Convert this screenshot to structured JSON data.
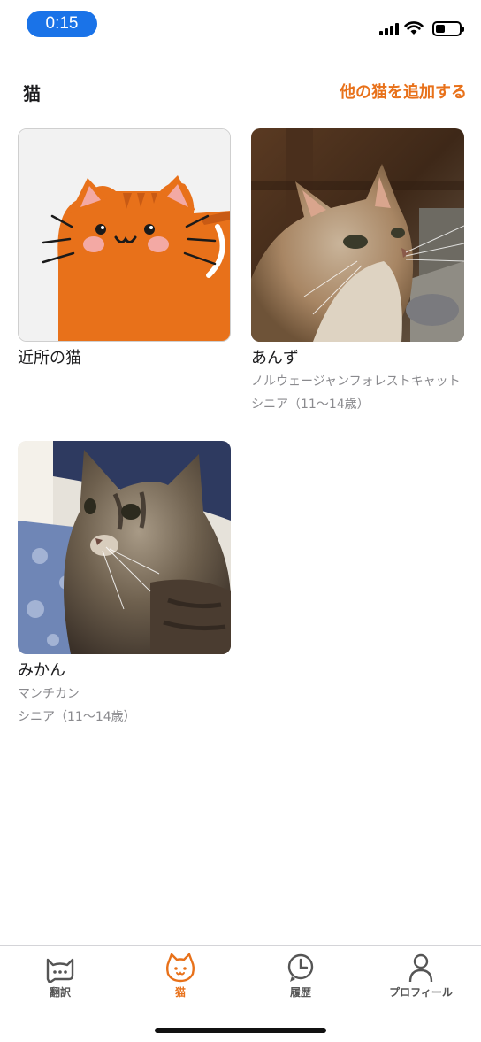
{
  "status_bar": {
    "time": "0:15"
  },
  "header": {
    "title": "猫",
    "add_cat_label": "他の猫を追加する"
  },
  "cats": [
    {
      "name": "近所の猫",
      "breed": "",
      "age": ""
    },
    {
      "name": "あんず",
      "breed": "ノルウェージャンフォレストキャット",
      "age": "シニア（11〜14歳）"
    },
    {
      "name": "みかん",
      "breed": "マンチカン",
      "age": "シニア（11〜14歳）"
    }
  ],
  "tabs": [
    {
      "label": "翻訳",
      "icon": "cat-speech-icon",
      "active": false
    },
    {
      "label": "猫",
      "icon": "cat-face-icon",
      "active": true
    },
    {
      "label": "履歴",
      "icon": "clock-icon",
      "active": false
    },
    {
      "label": "プロフィール",
      "icon": "person-icon",
      "active": false
    }
  ],
  "colors": {
    "accent": "#e8711a",
    "status_time_bg": "#1a73e8"
  }
}
